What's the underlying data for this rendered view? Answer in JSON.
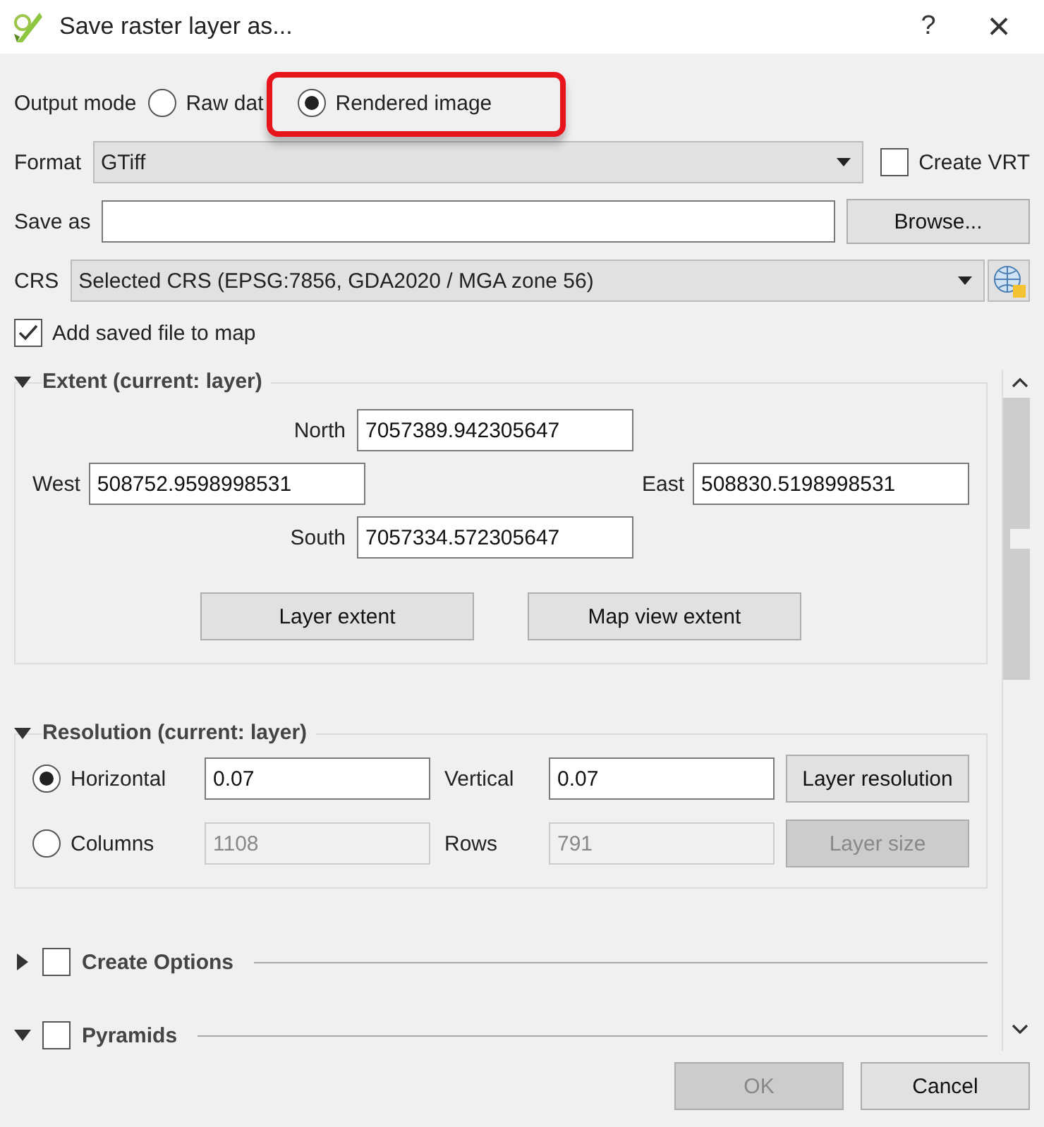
{
  "window": {
    "title": "Save raster layer as...",
    "help": "?",
    "close": "×"
  },
  "output_mode": {
    "label": "Output mode",
    "options": [
      {
        "label": "Raw dat",
        "selected": false,
        "highlighted": false
      },
      {
        "label": "Rendered image",
        "selected": true,
        "highlighted": true
      }
    ]
  },
  "format": {
    "label": "Format",
    "value": "GTiff"
  },
  "create_vrt": {
    "label": "Create VRT",
    "checked": false
  },
  "save_as": {
    "label": "Save as",
    "button": "Browse..."
  },
  "crs": {
    "label": "CRS",
    "value": "Selected CRS (EPSG:7856, GDA2020 / MGA zone 56)"
  },
  "add_to_map": {
    "label": "Add saved file to map",
    "checked": true
  },
  "extent": {
    "title": "Extent (current: layer)",
    "expanded": true,
    "north": {
      "label": "North",
      "value": "7057389.942305647"
    },
    "west": {
      "label": "West",
      "value": "508752.9598998531"
    },
    "east": {
      "label": "East",
      "value": "508830.5198998531"
    },
    "south": {
      "label": "South",
      "value": "7057334.572305647"
    },
    "buttons": [
      "Layer extent",
      "Map view extent"
    ]
  },
  "resolution": {
    "title": "Resolution (current: layer)",
    "expanded": true,
    "rows": [
      {
        "label": "Horizontal",
        "selected": true,
        "value": "0.07",
        "label2": "Vertical",
        "value2": "0.07",
        "button": "Layer resolution"
      },
      {
        "label": "Columns",
        "selected": false,
        "value": "1108",
        "label2": "Rows",
        "value2": "791",
        "button": "Layer size"
      }
    ]
  },
  "sections": [
    {
      "title": "Create Options",
      "expanded": false,
      "checked": false
    },
    {
      "title": "Pyramids",
      "expanded": true,
      "checked": false
    }
  ],
  "footer": [
    {
      "label": "OK",
      "disabled": true
    },
    {
      "label": "Cancel",
      "disabled": false
    }
  ]
}
